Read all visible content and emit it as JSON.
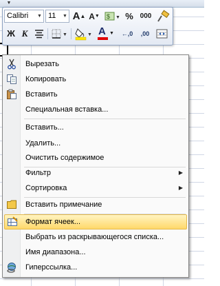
{
  "mini_toolbar": {
    "font_name": "Calibri",
    "font_size": "11",
    "grow_font": "A",
    "shrink_font": "A",
    "percent": "%",
    "thousands": "000",
    "bold": "Ж",
    "italic": "К",
    "font_color_letter": "А",
    "increase_decimal": "←,0",
    "decrease_decimal": ",00"
  },
  "context_menu": {
    "items": [
      {
        "label": "Вырезать",
        "icon": "scissors-icon"
      },
      {
        "label": "Копировать",
        "icon": "copy-icon"
      },
      {
        "label": "Вставить",
        "icon": "paste-icon"
      },
      {
        "label": "Специальная вставка..."
      },
      {
        "label": "Вставить..."
      },
      {
        "label": "Удалить..."
      },
      {
        "label": "Очистить содержимое"
      },
      {
        "label": "Фильтр",
        "submenu": true
      },
      {
        "label": "Сортировка",
        "submenu": true
      },
      {
        "label": "Вставить примечание",
        "icon": "comment-icon"
      },
      {
        "label": "Формат ячеек...",
        "icon": "format-cells-icon",
        "highlighted": true
      },
      {
        "label": "Выбрать из раскрывающегося списка..."
      },
      {
        "label": "Имя диапазона..."
      },
      {
        "label": "Гиперссылка...",
        "icon": "hyperlink-icon"
      }
    ]
  },
  "colors": {
    "highlight": "#ffd86a",
    "fill_color": "#ffe600",
    "font_color": "#e00000"
  }
}
